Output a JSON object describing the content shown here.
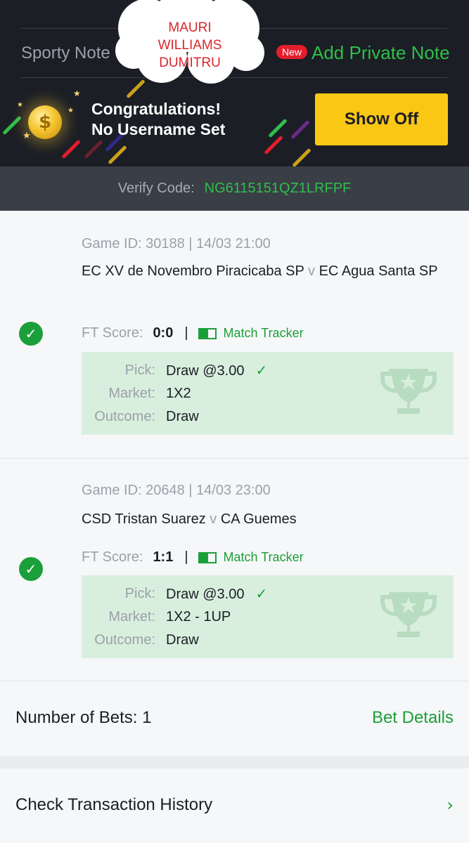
{
  "header": {
    "sporty_note": "Sporty Note",
    "new_badge": "New",
    "add_private_note": "Add Private Note",
    "congrats_line1": "Congratulations!",
    "congrats_line2": "No Username Set",
    "show_off": "Show Off",
    "sticker_line1": "MAURI",
    "sticker_line2": "WILLIAMS",
    "sticker_line3": "DUMITRU",
    "coin_symbol": "$"
  },
  "verify": {
    "label": "Verify Code:",
    "code": "NG6115151QZ1LRFPF"
  },
  "games": [
    {
      "game_id": "Game ID: 30188 | 14/03 21:00",
      "home": "EC XV de Novembro Piracicaba SP",
      "vs": "v",
      "away": "EC Agua Santa SP",
      "ft_label": "FT Score:",
      "ft_score": "0:0",
      "separator": "|",
      "tracker": "Match Tracker",
      "pick_label": "Pick:",
      "pick": "Draw @3.00",
      "market_label": "Market:",
      "market": "1X2",
      "outcome_label": "Outcome:",
      "outcome": "Draw",
      "status_icon": "check-circle-icon"
    },
    {
      "game_id": "Game ID: 20648 | 14/03 23:00",
      "home": "CSD Tristan Suarez",
      "vs": "v",
      "away": "CA Guemes",
      "ft_label": "FT Score:",
      "ft_score": "1:1",
      "separator": "|",
      "tracker": "Match Tracker",
      "pick_label": "Pick:",
      "pick": "Draw @3.00",
      "market_label": "Market:",
      "market": "1X2 - 1UP",
      "outcome_label": "Outcome:",
      "outcome": "Draw",
      "status_icon": "check-circle-icon"
    }
  ],
  "footer": {
    "number_of_bets": "Number of Bets: 1",
    "bet_details": "Bet Details",
    "check_history": "Check Transaction History"
  },
  "colors": {
    "accent_green": "#1b9f3a",
    "bright_green": "#2fbf4a",
    "yellow": "#fbc715",
    "dark_bg": "#1b1e25",
    "win_bg": "#d9efde"
  }
}
